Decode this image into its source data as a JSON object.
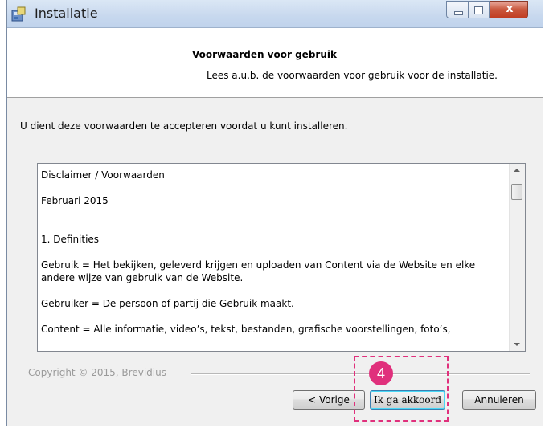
{
  "window": {
    "title": "Installatie",
    "close_glyph": "x",
    "icon": "installer-icon"
  },
  "header": {
    "title": "Voorwaarden voor gebruik",
    "subtitle": "Lees a.u.b. de voorwaarden voor gebruik voor de installatie."
  },
  "intro_text": "U dient deze voorwaarden te accepteren voordat u kunt installeren.",
  "license": {
    "paragraphs": [
      "Disclaimer / Voorwaarden",
      "Februari 2015",
      "1. Definities",
      "Gebruik  = Het bekijken, geleverd krijgen en uploaden van Content via de Website en elke andere wijze van gebruik van de Website.",
      "Gebruiker = De persoon of partij die Gebruik maakt.",
      "Content = Alle informatie, video’s, tekst, bestanden, grafische voorstellingen, foto’s,"
    ]
  },
  "footer": {
    "copyright": "Copyright © 2015, Brevidius",
    "buttons": {
      "prev": "< Vorige",
      "agree": "Ik ga akkoord",
      "cancel": "Annuleren"
    }
  },
  "annotation": {
    "step_number": "4",
    "color": "#e0307c"
  },
  "colors": {
    "titlebar": "#c7d8ee",
    "close_button": "#c13d22",
    "window_bg": "#f0f0f0"
  }
}
